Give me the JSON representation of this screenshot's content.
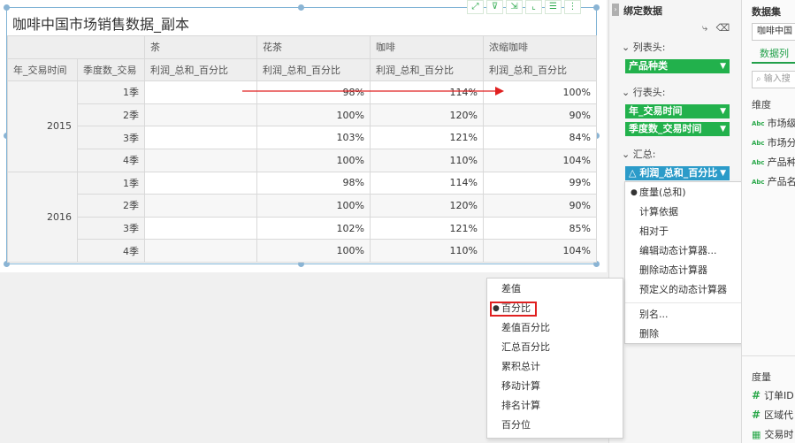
{
  "report": {
    "title": "咖啡中国市场销售数据_副本",
    "toolbar": [
      "expand-icon",
      "filter-icon",
      "export-icon",
      "chart-icon",
      "list-icon",
      "more-icon"
    ]
  },
  "table": {
    "col_header_top": [
      "茶",
      "花茶",
      "咖啡",
      "浓缩咖啡"
    ],
    "row_header_labels": [
      "年_交易时间",
      "季度数_交易"
    ],
    "measure_label": "利润_总和_百分比",
    "years": [
      {
        "year": "2015",
        "rows": [
          {
            "quarter": "1季",
            "values": [
              "",
              "98%",
              "114%",
              "100%"
            ]
          },
          {
            "quarter": "2季",
            "values": [
              "",
              "100%",
              "120%",
              "90%"
            ]
          },
          {
            "quarter": "3季",
            "values": [
              "",
              "103%",
              "121%",
              "84%"
            ]
          },
          {
            "quarter": "4季",
            "values": [
              "",
              "100%",
              "110%",
              "104%"
            ]
          }
        ]
      },
      {
        "year": "2016",
        "rows": [
          {
            "quarter": "1季",
            "values": [
              "",
              "98%",
              "114%",
              "99%"
            ]
          },
          {
            "quarter": "2季",
            "values": [
              "",
              "100%",
              "120%",
              "90%"
            ]
          },
          {
            "quarter": "3季",
            "values": [
              "",
              "102%",
              "121%",
              "85%"
            ]
          },
          {
            "quarter": "4季",
            "values": [
              "",
              "100%",
              "110%",
              "104%"
            ]
          }
        ]
      }
    ]
  },
  "bind_panel": {
    "title": "绑定数据",
    "columns_label": "列表头:",
    "columns_field": "产品种类",
    "rows_label": "行表头:",
    "rows_fields": [
      "年_交易时间",
      "季度数_交易时间"
    ],
    "summary_label": "汇总:",
    "summary_field": "利润_总和_百分比"
  },
  "context_menu": {
    "items": [
      "度量(总和)",
      "计算依据",
      "相对于",
      "编辑动态计算器...",
      "删除动态计算器",
      "预定义的动态计算器",
      "别名...",
      "删除"
    ]
  },
  "sub_menu": {
    "items": [
      "差值",
      "百分比",
      "差值百分比",
      "汇总百分比",
      "累积总计",
      "移动计算",
      "排名计算",
      "百分位"
    ],
    "selected": "百分比"
  },
  "dataset_panel": {
    "title": "数据集",
    "dataset": "咖啡中国",
    "tab": "数据列",
    "search_placeholder": "输入搜",
    "dimension_label": "维度",
    "dimensions": [
      "市场级",
      "市场分",
      "产品种",
      "产品名"
    ],
    "measure_label": "度量",
    "measures": [
      "订单ID",
      "区域代",
      "交易时"
    ]
  },
  "colors": {
    "accent_green": "#22b14c",
    "accent_blue": "#2b9bc9",
    "highlight_red": "#e02020",
    "selection_border": "#7fb3d5"
  }
}
